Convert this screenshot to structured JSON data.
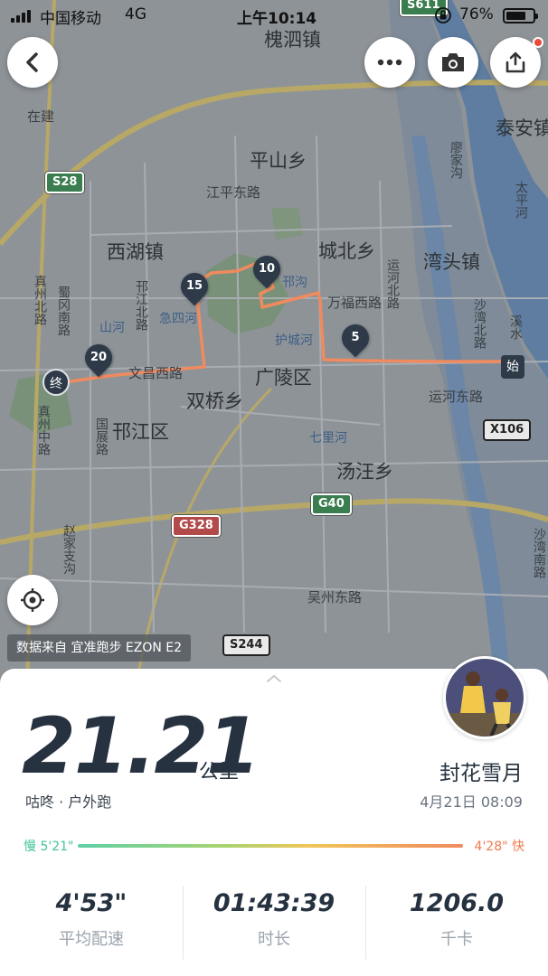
{
  "status_bar": {
    "carrier": "中国移动",
    "network": "4G",
    "time": "上午10:14",
    "battery_percent": "76%",
    "battery_level": 0.76
  },
  "map": {
    "places": {
      "huaisi": "槐泗镇",
      "pingshan": "平山乡",
      "xihu": "西湖镇",
      "chengbei": "城北乡",
      "wantou": "湾头镇",
      "guangling": "广陵区",
      "shuangqiao": "双桥乡",
      "hanjiang": "邗江区",
      "tangwang": "汤汪乡",
      "taian": "泰安镇",
      "zaijian": "在建",
      "jiangping_rd": "江平东路",
      "wanfu_rd": "万福西路",
      "wenchang_rd": "文昌西路",
      "yunhe_e_rd": "运河东路",
      "yunhe_n_rd": "运河北路",
      "wuzhou_rd": "吴州东路",
      "hanjiang_n_rd": "邗江北路",
      "zhenzhou_n_rd": "真州北路",
      "zhenzhou_c_rd": "真州中路",
      "shuguang_s_rd": "蜀冈南路",
      "guoqing_rd": "国展路",
      "shawan_n_rd": "沙湾北路",
      "shawan_s_rd": "沙湾南路",
      "zhaixiao_rd": "赵家支沟",
      "shanhe": "山河",
      "hanggou": "邗沟",
      "hucheng": "护城河",
      "jisihe": "急四河",
      "qilihe": "七里河",
      "renjiahe": "廖家沟",
      "taiping": "太平河",
      "xinjiang": "溪水"
    },
    "shields": {
      "s28": "S28",
      "s611": "S611",
      "g40": "G40",
      "g328": "G328",
      "x106": "X106",
      "s244": "S244"
    },
    "markers": {
      "start": "始",
      "end": "终",
      "km5": "5",
      "km10": "10",
      "km15": "15",
      "km20": "20"
    },
    "data_source": "数据来自 宜准跑步 EZON E2"
  },
  "summary": {
    "distance": "21.21",
    "unit": "公里",
    "sport": "咕咚 · 户外跑",
    "user_name": "封花雪月",
    "date": "4月21日 08:09",
    "pace_slow": "慢 5'21\"",
    "pace_fast": "4'28\" 快"
  },
  "stats": [
    {
      "value": "4'53\"",
      "label": "平均配速"
    },
    {
      "value": "01:43:39",
      "label": "时长"
    },
    {
      "value": "1206.0",
      "label": "千卡"
    }
  ],
  "colors": {
    "route": "#f08a5f",
    "marker": "#2e3a48",
    "text_dark": "#263240"
  }
}
